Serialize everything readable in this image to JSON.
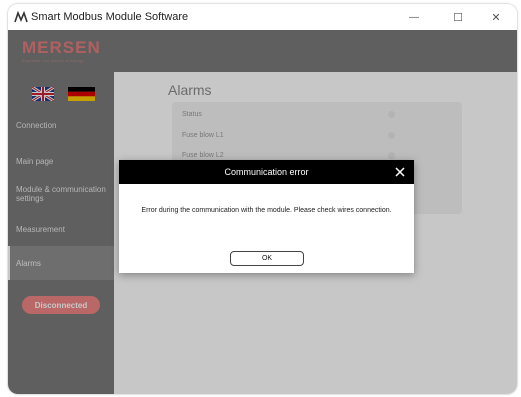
{
  "window": {
    "title": "Smart Modbus Module Software",
    "minimize_glyph": "—",
    "maximize_glyph": "☐",
    "close_glyph": "✕"
  },
  "brand": {
    "name": "MERSEN",
    "tagline": "Expertise, our source of energy",
    "colors": {
      "brand": "#e27c7c"
    }
  },
  "sidebar": {
    "languages": [
      "English",
      "Deutsch"
    ],
    "items": [
      {
        "label": "Connection"
      },
      {
        "label": "Main page"
      },
      {
        "label": "Module & communication settings"
      },
      {
        "label": "Measurement"
      },
      {
        "label": "Alarms",
        "active": true
      }
    ],
    "status_label": "Disconnected"
  },
  "main": {
    "title": "Alarms",
    "alarms": [
      {
        "label": "Status"
      },
      {
        "label": "Fuse blow L1"
      },
      {
        "label": "Fuse blow L2"
      }
    ]
  },
  "dialog": {
    "title": "Communication error",
    "message": "Error during the communication with the module. Please check wires connection.",
    "ok_label": "OK"
  }
}
